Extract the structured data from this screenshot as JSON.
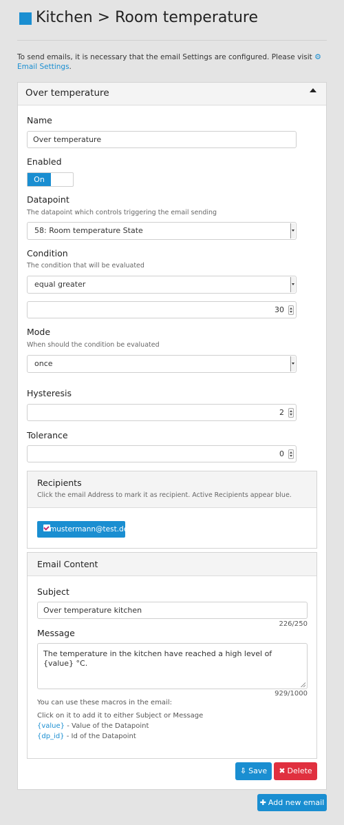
{
  "header": {
    "title": "Kitchen > Room temperature",
    "info_text": "To send emails, it is necessary that the email Settings are configured. Please visit",
    "info_link": "Email Settings",
    "info_end": "."
  },
  "panel": {
    "title": "Over temperature",
    "name": {
      "label": "Name",
      "value": "Over temperature"
    },
    "enabled": {
      "label": "Enabled",
      "state": "On"
    },
    "datapoint": {
      "label": "Datapoint",
      "help": "The datapoint which controls triggering the email sending",
      "value": "58: Room temperature State"
    },
    "condition": {
      "label": "Condition",
      "help": "The condition that will be evaluated",
      "value": "equal greater",
      "threshold": "30"
    },
    "mode": {
      "label": "Mode",
      "help": "When should the condition be evaluated",
      "value": "once"
    },
    "hysteresis": {
      "label": "Hysteresis",
      "value": "2"
    },
    "tolerance": {
      "label": "Tolerance",
      "value": "0"
    },
    "recipients": {
      "title": "Recipients",
      "help": "Click the email Address to mark it as recipient. Active Recipients appear blue.",
      "items": [
        "mustermann@test.de"
      ]
    },
    "email_content": {
      "title": "Email Content",
      "subject_label": "Subject",
      "subject_value": "Over temperature kitchen",
      "subject_counter": "226/250",
      "message_label": "Message",
      "message_value": "The temperature in the kitchen have reached a high level of {value} °C.",
      "message_counter": "929/1000",
      "macros_title": "You can use these macros in the email:",
      "macros_help": "Click on it to add it to either Subject or Message",
      "macros": [
        {
          "key": "{value}",
          "desc": " - Value of the Datapoint"
        },
        {
          "key": "{dp_id}",
          "desc": " - Id of the Datapoint"
        }
      ]
    },
    "buttons": {
      "save": "Save",
      "delete": "Delete"
    }
  },
  "footer": {
    "add_label": "Add new email"
  },
  "colors": {
    "accent": "#1a8ed1",
    "danger": "#e0303f",
    "macro_check": "#c0256e"
  },
  "icons": [
    "title-square-icon",
    "gear-icon",
    "caret-up-icon",
    "checkbox-icon",
    "save-icon",
    "delete-x-icon",
    "plus-icon"
  ]
}
